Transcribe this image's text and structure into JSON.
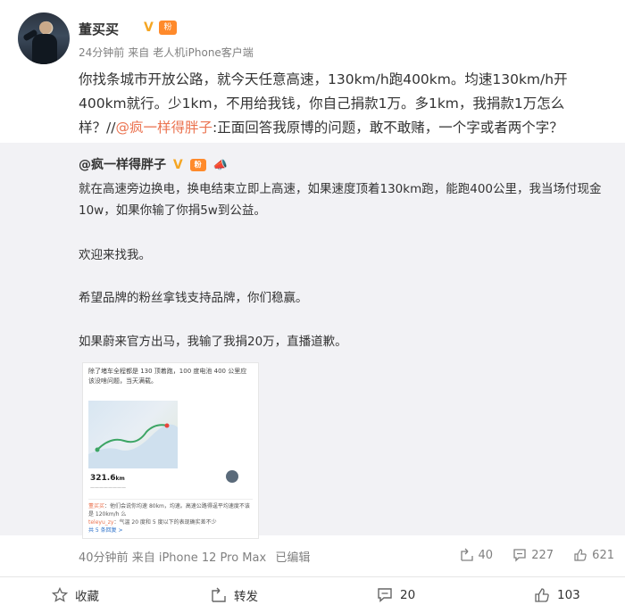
{
  "post": {
    "author": "董买买",
    "time": "24分钟前",
    "source_prefix": "来自",
    "source": "老人机iPhone客户端",
    "fan_badge": "粉",
    "text_before_mention": "你找条城市开放公路，就今天任意高速，130km/h跑400km。均速130km/h开400km就行。少1km，不用给我钱，你自己捐款1万。多1km，我捐款1万怎么样？//",
    "mention": "@疯一样得胖子",
    "text_after_mention": ":正面回答我原博的问题，敢不敢赌，一个字或者两个字？"
  },
  "retweet": {
    "author": "@疯一样得胖子",
    "fan_badge": "粉",
    "paragraphs": [
      "就在高速旁边换电，换电结束立即上高速，如果速度顶着130km跑，能跑400公里，我当场付现金10w，如果你输了你捐5w到公益。",
      "欢迎来找我。",
      "希望品牌的粉丝拿钱支持品牌，你们稳赢。",
      "如果蔚来官方出马，我输了我捐20万，直播道歉。"
    ],
    "image": {
      "caption": "除了堵车全程都是 130 顶着跑，100 度电池 400 公里应该没啥问题，当天满载。",
      "distance": "321.6",
      "distance_unit": "km",
      "comment1_name": "董买买",
      "comment1_text": "他们会说你均速 80km，均速。高速公路得逞平均速度不该是 120km/h 么",
      "comment2_name": "teleyu_zy",
      "comment2_text": "气温 20 度和 5 度以下的表现确实差不少",
      "more_replies": "共 5 条回复 >"
    },
    "footer": {
      "time": "40分钟前",
      "source_prefix": "来自",
      "source": "iPhone 12 Pro Max",
      "edited": "已编辑",
      "reposts": "40",
      "comments": "227",
      "likes": "621"
    }
  },
  "actions": {
    "favorite": "收藏",
    "repost": "转发",
    "comment": "20",
    "like": "103"
  },
  "colors": {
    "mention": "#eb7350",
    "retweet_bg": "#f2f2f5",
    "badge_orange": "#ff8a2b",
    "verified_gold": "#f5a623"
  }
}
